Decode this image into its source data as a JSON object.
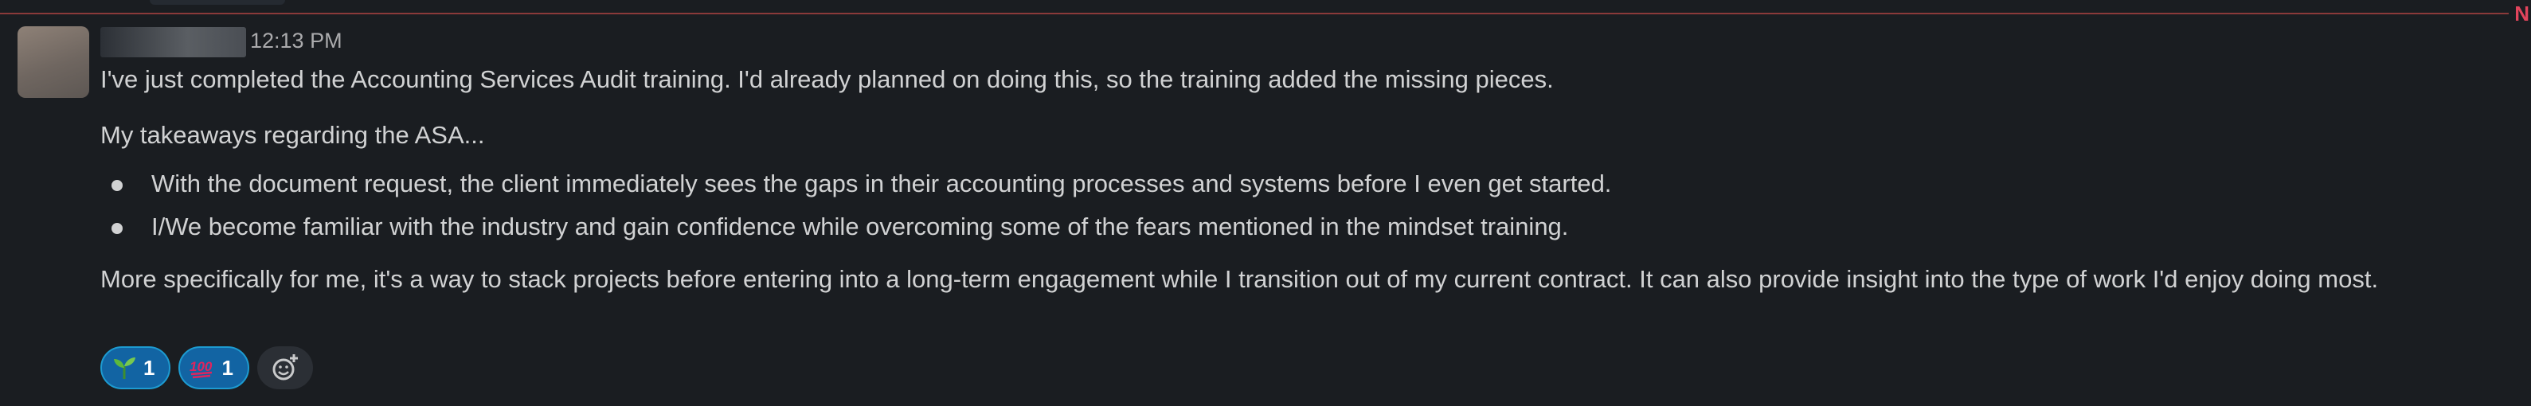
{
  "header": {
    "new_label": "N"
  },
  "message": {
    "sender_name": "",
    "timestamp": "12:13 PM",
    "paragraph1": "I've just completed the Accounting Services Audit training. I'd already planned on doing this, so the training added the missing pieces.",
    "paragraph2": "My takeaways regarding the ASA...",
    "bullets": [
      "With the document request, the client immediately sees the gaps in their accounting processes and systems before I even get started.",
      "I/We become familiar with the industry and gain confidence while overcoming some of the fears mentioned in the mindset training."
    ],
    "paragraph3": "More specifically for me, it's a way to stack projects before entering into a long-term engagement while I transition out of my current contract. It can also provide insight into the type of work I'd enjoy doing most."
  },
  "reactions": [
    {
      "icon": "seedling-emoji",
      "count": "1"
    },
    {
      "icon": "hundred-points-emoji",
      "count": "1"
    }
  ],
  "colors": {
    "background": "#1a1d21",
    "text": "#d1d2d3",
    "reaction_bg": "#1264a3",
    "new_divider": "#8b3a3a"
  }
}
